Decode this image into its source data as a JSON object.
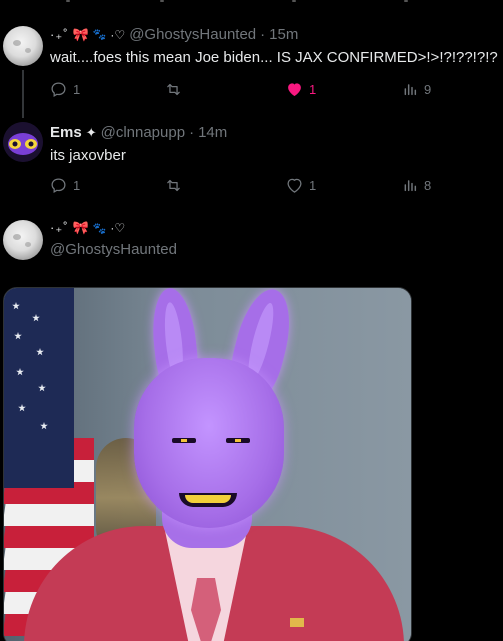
{
  "tweets": [
    {
      "display_name_deco": "·₊˚",
      "display_name_bow": "🎀",
      "display_name_paw": "🐾",
      "display_name_tail": "·♡",
      "handle": "@GhostysHaunted",
      "time": "15m",
      "text": "wait....foes this mean Joe biden... IS JAX CONFIRMED>!>!?!??!?!?",
      "actions": {
        "replies": "1",
        "retweets": "",
        "likes": "1",
        "liked": true,
        "views": "9"
      }
    },
    {
      "display_name": "Ems",
      "verified_symbol": "✦",
      "handle": "@clnnapupp",
      "time": "14m",
      "text": "its jaxovber",
      "actions": {
        "replies": "1",
        "retweets": "",
        "likes": "1",
        "liked": false,
        "views": "8"
      }
    },
    {
      "display_name_deco": "·₊˚",
      "display_name_bow": "🎀",
      "display_name_paw": "🐾",
      "display_name_tail": "·♡",
      "handle": "@GhostysHaunted"
    }
  ],
  "separator": "·",
  "colors": {
    "background": "#000000",
    "text": "#e7e9ea",
    "muted": "#71767b",
    "like": "#f91880"
  },
  "icons": [
    "reply-icon",
    "retweet-icon",
    "like-icon",
    "views-icon"
  ]
}
